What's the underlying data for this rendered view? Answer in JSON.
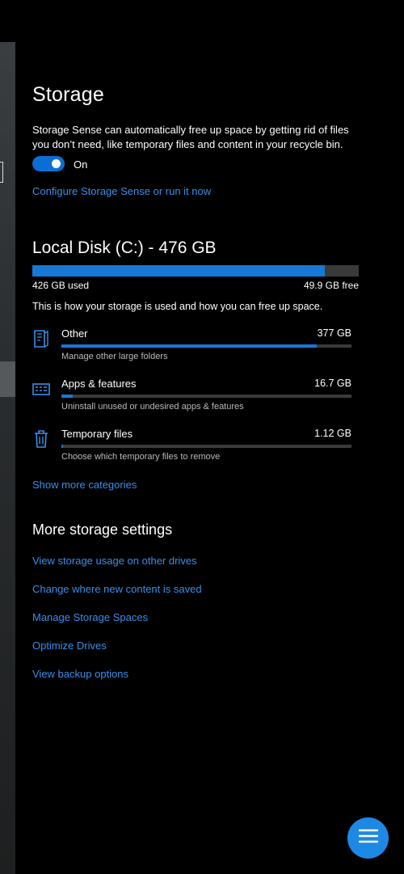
{
  "page": {
    "title": "Storage",
    "description": "Storage Sense can automatically free up space by getting rid of files you don’t need, like temporary files and content in your recycle bin.",
    "toggle": {
      "state": "On",
      "on": true
    },
    "configure_link": "Configure Storage Sense or run it now"
  },
  "disk": {
    "title": "Local Disk (C:) - 476 GB",
    "used_label": "426 GB used",
    "free_label": "49.9 GB free",
    "used_fraction": 0.895,
    "usage_description": "This is how your storage is used and how you can free up space."
  },
  "categories": [
    {
      "icon": "document-icon",
      "name": "Other",
      "size": "377 GB",
      "fraction": 0.88,
      "subtitle": "Manage other large folders"
    },
    {
      "icon": "apps-icon",
      "name": "Apps & features",
      "size": "16.7 GB",
      "fraction": 0.04,
      "subtitle": "Uninstall unused or undesired apps & features"
    },
    {
      "icon": "trash-icon",
      "name": "Temporary files",
      "size": "1.12 GB",
      "fraction": 0.005,
      "subtitle": "Choose which temporary files to remove"
    }
  ],
  "show_more": "Show more categories",
  "more_settings": {
    "title": "More storage settings",
    "links": [
      "View storage usage on other drives",
      "Change where new content is saved",
      "Manage Storage Spaces",
      "Optimize Drives",
      "View backup options"
    ]
  },
  "colors": {
    "accent": "#1679d6",
    "link": "#3b8ee8",
    "fab": "#1e88e5"
  },
  "fab_icon": "menu-icon"
}
